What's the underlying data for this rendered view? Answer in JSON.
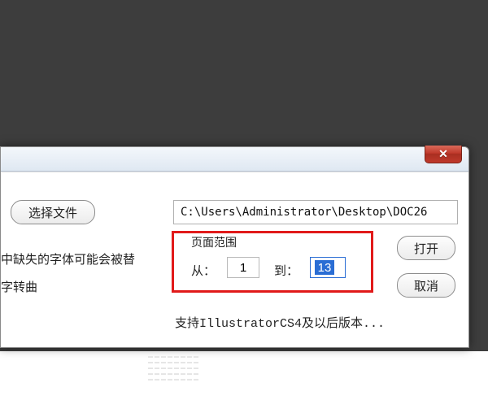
{
  "dialog": {
    "close_glyph": "✕",
    "select_file_label": "选择文件",
    "path_value": "C:\\Users\\Administrator\\Desktop\\DOC26",
    "open_label": "打开",
    "cancel_label": "取消",
    "left_text_line1": "中缺失的字体可能会被替",
    "left_text_line2": "字转曲",
    "page_range": {
      "group_label": "页面范围",
      "from_label": "从：",
      "from_value": "1",
      "to_label": "到：",
      "to_value": "13"
    },
    "footer_hint": "支持IllustratorCS4及以后版本..."
  }
}
